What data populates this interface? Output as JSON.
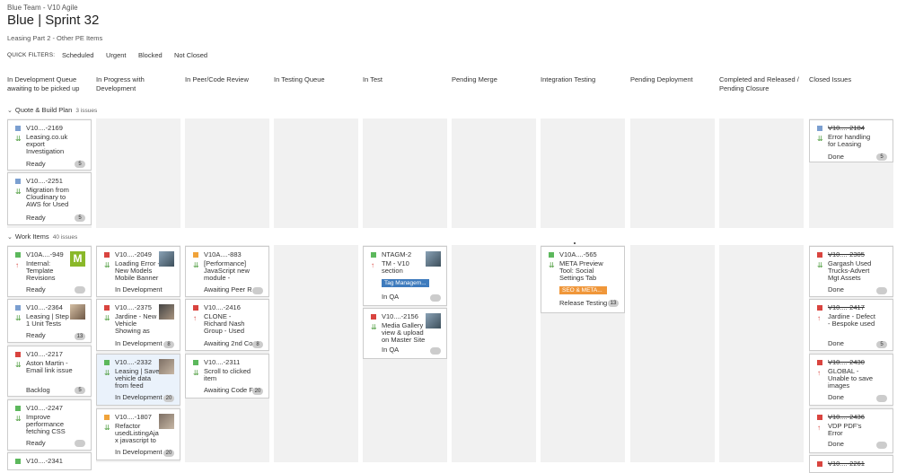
{
  "header": {
    "breadcrumb": "Blue Team - V10 Agile",
    "title": "Blue | Sprint 32",
    "subtitle": "Leasing Part 2 - Other PE Items"
  },
  "quick_filters": {
    "label": "QUICK FILTERS:",
    "items": [
      "Scheduled",
      "Urgent",
      "Blocked",
      "Not Closed"
    ]
  },
  "columns": [
    "In Development Queue awaiting to be picked up",
    "In Progress with Development",
    "In Peer/Code Review",
    "In Testing Queue",
    "In Test",
    "Pending Merge",
    "Integration Testing",
    "Pending Deployment",
    "Completed and Released / Pending Closure",
    "Closed Issues"
  ],
  "swimlanes": [
    {
      "title": "Quote & Build Plan",
      "count": "3 issues"
    },
    {
      "title": "Work Items",
      "count": "40 issues"
    }
  ],
  "icons": {
    "chevron": "chevron-down-icon",
    "priority_up": "arrow-up-icon",
    "priority_down": "double-chevron-down-icon"
  },
  "colors": {
    "story": "#5cb85c",
    "bug": "#d9443f",
    "task": "#7b9fd0",
    "improvement": "#f0a33a",
    "label_blue": "#3e7bbd",
    "label_orange": "#f0973a"
  },
  "cards": {
    "q1": {
      "key": "V10....-2169",
      "summary": "Leasing.co.uk export Investigation",
      "status": "Ready",
      "badge": "5"
    },
    "q2": {
      "key": "V10....-2251",
      "summary": "Migration from Cloudinary to AWS for Used",
      "status": "Ready",
      "badge": "5"
    },
    "q3": {
      "key": "V10....-2184",
      "summary": "Error handling for Leasing",
      "status": "Done",
      "badge": "5"
    },
    "w1": {
      "key": "V10A....-949",
      "summary": "Internal: Template Revisions",
      "status": "Ready",
      "avatar": "M"
    },
    "w2": {
      "key": "V10....-2364",
      "summary": "Leasing | Step 1 Unit Tests",
      "status": "Ready",
      "badge": "13"
    },
    "w3": {
      "key": "V10....-2217",
      "summary": "Aston Martin - Email link issue",
      "status": "Backlog",
      "badge": "5"
    },
    "w4": {
      "key": "V10....-2247",
      "summary": "Improve performance fetching CSS",
      "status": "Ready"
    },
    "w5": {
      "key": "V10....-2341"
    },
    "p1": {
      "key": "V10....-2049",
      "summary": "Loading Error - New Models Mobile Banner",
      "status": "In Development"
    },
    "p2": {
      "key": "V10....-2375",
      "summary": "Jardine - New Vehicle Showing as",
      "status": "In Development",
      "badge": "8"
    },
    "p3": {
      "key": "V10....-2332",
      "summary": "Leasing | Save vehicle data from feed",
      "status": "In Development",
      "badge": "20"
    },
    "p4": {
      "key": "V10....-1807",
      "summary": "Refactor usedListingAja x javascript to",
      "status": "In Development",
      "badge": "20"
    },
    "r1": {
      "key": "V10A....-883",
      "summary": "[Performance] JavaScript new module -",
      "status": "Awaiting Peer R"
    },
    "r2": {
      "key": "V10....-2416",
      "summary": "CLONE - Richard Nash Group - Used",
      "status": "Awaiting 2nd Co",
      "badge": "8"
    },
    "r3": {
      "key": "V10....-2311",
      "summary": "Scroll to clicked item",
      "status": "Awaiting Code F",
      "badge": "20"
    },
    "t1": {
      "key": "NTAGM-2",
      "summary": "TM - V10 section",
      "label": "Tag Managem...",
      "status": "In QA"
    },
    "t2": {
      "key": "V10....-2156",
      "summary": "Media Gallery view & upload on Master Site",
      "status": "In QA"
    },
    "i1": {
      "key": "V10A....-565",
      "summary": "META Preview Tool: Social Settings Tab",
      "label": "SEO & META...",
      "status": "Release Testing",
      "badge": "13"
    },
    "c1": {
      "key": "V10....-2305",
      "summary": "Gargash Used Trucks-Advert Mgt Assets",
      "status": "Done"
    },
    "c2": {
      "key": "V10....-2417",
      "summary": "Jardine - Defect - Bespoke used",
      "status": "Done",
      "badge": "5"
    },
    "c3": {
      "key": "V10....-2430",
      "summary": "GLOBAL - Unable to save images",
      "status": "Done"
    },
    "c4": {
      "key": "V10....-2436",
      "summary": "VDP PDF's Error",
      "status": "Done"
    },
    "c5": {
      "key": "V10....-2261"
    }
  }
}
